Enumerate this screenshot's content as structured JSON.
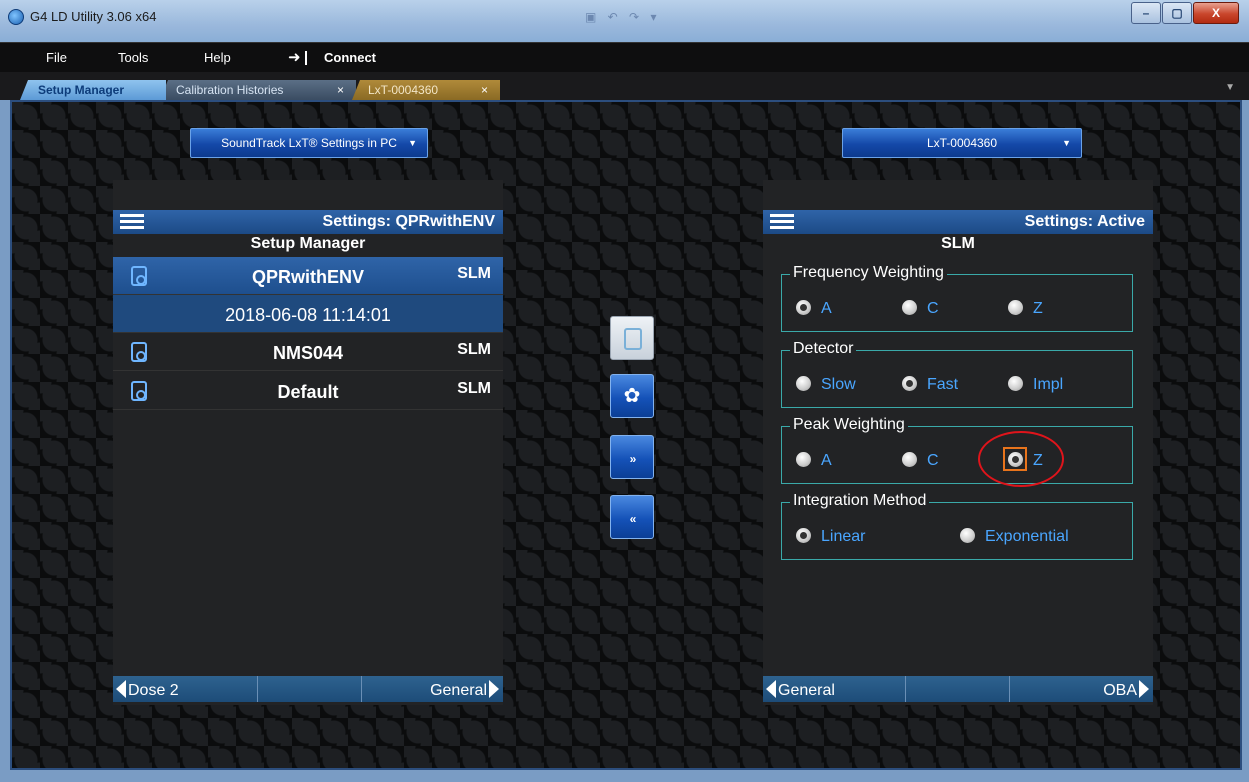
{
  "window": {
    "title": "G4 LD Utility 3.06 x64",
    "minimize": "–",
    "maximize": "▢",
    "close": "X"
  },
  "menu": {
    "file": "File",
    "tools": "Tools",
    "help": "Help",
    "connect": "Connect"
  },
  "tabs": [
    {
      "label": "Setup Manager"
    },
    {
      "label": "Calibration Histories",
      "close": "×"
    },
    {
      "label": "LxT-0004360",
      "close": "×"
    }
  ],
  "left": {
    "source_button": "SoundTrack LxT® Settings in PC",
    "header_title": "Settings: QPRwithENV",
    "subtitle": "Setup Manager",
    "rows": [
      {
        "name": "QPRwithENV",
        "type": "SLM"
      },
      {
        "name": "2018-06-08 11:14:01"
      },
      {
        "name": "NMS044",
        "type": "SLM"
      },
      {
        "name": "Default",
        "type": "SLM"
      }
    ],
    "footer_left": "Dose 2",
    "footer_right": "General"
  },
  "middle": {
    "gear_symbol": "✿",
    "forward_symbol": "»",
    "back_symbol": "«"
  },
  "right": {
    "source_button": "LxT-0004360",
    "header_title": "Settings: Active",
    "subtitle": "SLM",
    "groups": [
      {
        "title": "Frequency Weighting",
        "options": [
          "A",
          "C",
          "Z"
        ],
        "selected": "A"
      },
      {
        "title": "Detector",
        "options": [
          "Slow",
          "Fast",
          "Impl"
        ],
        "selected": "Fast"
      },
      {
        "title": "Peak Weighting",
        "options": [
          "A",
          "C",
          "Z"
        ],
        "selected": "Z"
      },
      {
        "title": "Integration Method",
        "options": [
          "Linear",
          "Exponential"
        ],
        "selected": "Linear"
      }
    ],
    "footer_left": "General",
    "footer_right": "OBA"
  },
  "colors": {
    "accent_blue": "#1c4a86",
    "radio_text": "#4aa6ff",
    "group_border": "#3aa9a9",
    "highlight_circle": "#e0141b",
    "focus_border": "#e8741c"
  }
}
